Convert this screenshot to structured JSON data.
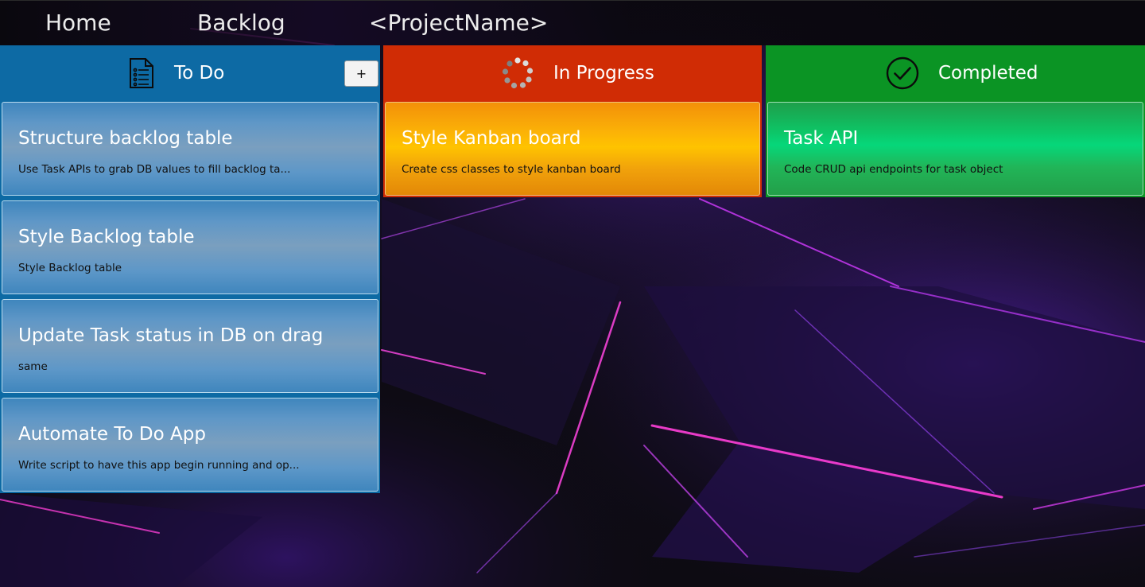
{
  "nav": {
    "home": "Home",
    "backlog": "Backlog",
    "project": "<ProjectName>"
  },
  "columns": {
    "todo": {
      "title": "To Do",
      "icon": "checklist-document-icon",
      "add_label": "+",
      "color": "#0d6aa4",
      "cards": [
        {
          "title": "Structure backlog table",
          "desc": "Use Task APIs to grab DB values to fill backlog ta..."
        },
        {
          "title": "Style Backlog table",
          "desc": "Style Backlog table"
        },
        {
          "title": "Update Task status in DB on drag",
          "desc": "same"
        },
        {
          "title": "Automate To Do App",
          "desc": "Write script to have this app begin running and op..."
        }
      ]
    },
    "in_progress": {
      "title": "In Progress",
      "icon": "loading-spinner-icon",
      "color": "#d02c05",
      "cards": [
        {
          "title": "Style Kanban board",
          "desc": "Create css classes to style kanban board"
        }
      ]
    },
    "completed": {
      "title": "Completed",
      "icon": "check-circle-icon",
      "color": "#0b9424",
      "cards": [
        {
          "title": "Task API",
          "desc": "Code CRUD api endpoints for task object"
        }
      ]
    }
  }
}
